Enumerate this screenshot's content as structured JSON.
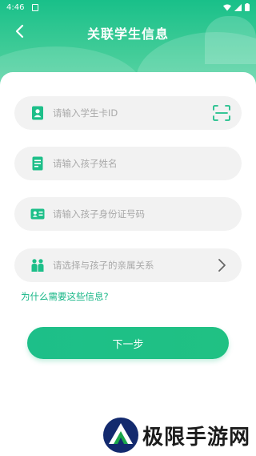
{
  "status_bar": {
    "time": "4:46"
  },
  "header": {
    "title": "关联学生信息"
  },
  "fields": [
    {
      "placeholder": "请输入学生卡ID",
      "icon": "student-card-icon",
      "trailing_icon": "scan-icon"
    },
    {
      "placeholder": "请输入孩子姓名",
      "icon": "name-doc-icon"
    },
    {
      "placeholder": "请输入孩子身份证号码",
      "icon": "id-card-icon"
    },
    {
      "placeholder": "请选择与孩子的亲属关系",
      "icon": "family-icon",
      "trailing_icon": "chevron-right-icon"
    }
  ],
  "why_link": "为什么需要这些信息?",
  "next_button": "下一步",
  "watermark": "极限手游网",
  "colors": {
    "accent": "#1dbf89",
    "field_bg": "#f2f2f2",
    "placeholder": "#a9a9a9"
  }
}
